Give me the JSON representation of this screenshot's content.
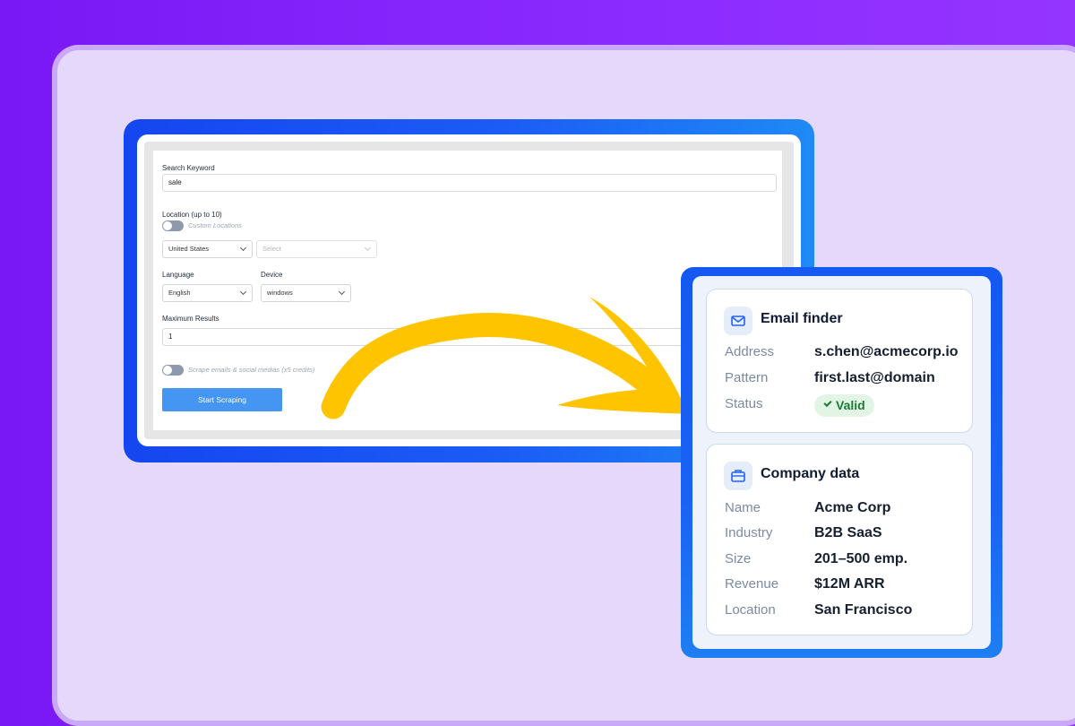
{
  "form": {
    "search_keyword_label": "Search Keyword",
    "search_keyword_value": "sale",
    "location_label": "Location (up to 10)",
    "custom_locations_label": "Custom Locations",
    "country_value": "United States",
    "region_placeholder": "Select",
    "language_label": "Language",
    "language_value": "English",
    "device_label": "Device",
    "device_value": "windows",
    "max_results_label": "Maximum Results",
    "max_results_value": "1",
    "scrape_emails_label": "Scrape emails & social medias (x5 credits)",
    "start_button": "Start Scraping"
  },
  "email_card": {
    "title": "Email finder",
    "icon": "mail-icon",
    "rows": [
      {
        "key": "Address",
        "value": "s.chen@acmecorp.io"
      },
      {
        "key": "Pattern",
        "value": "first.last@domain"
      },
      {
        "key": "Status",
        "value": "Valid"
      }
    ]
  },
  "company_card": {
    "title": "Company data",
    "icon": "briefcase-icon",
    "rows": [
      {
        "key": "Name",
        "value": "Acme Corp"
      },
      {
        "key": "Industry",
        "value": "B2B SaaS"
      },
      {
        "key": "Size",
        "value": "201–500 emp."
      },
      {
        "key": "Revenue",
        "value": "$12M ARR"
      },
      {
        "key": "Location",
        "value": "San Francisco"
      }
    ]
  },
  "colors": {
    "background": "#8c2bff",
    "canvas": "#e6d8fb",
    "frame_blue": "#1a55f2",
    "arrow": "#ffc400",
    "button": "#4595f2",
    "status_valid": "#1d7a34"
  }
}
